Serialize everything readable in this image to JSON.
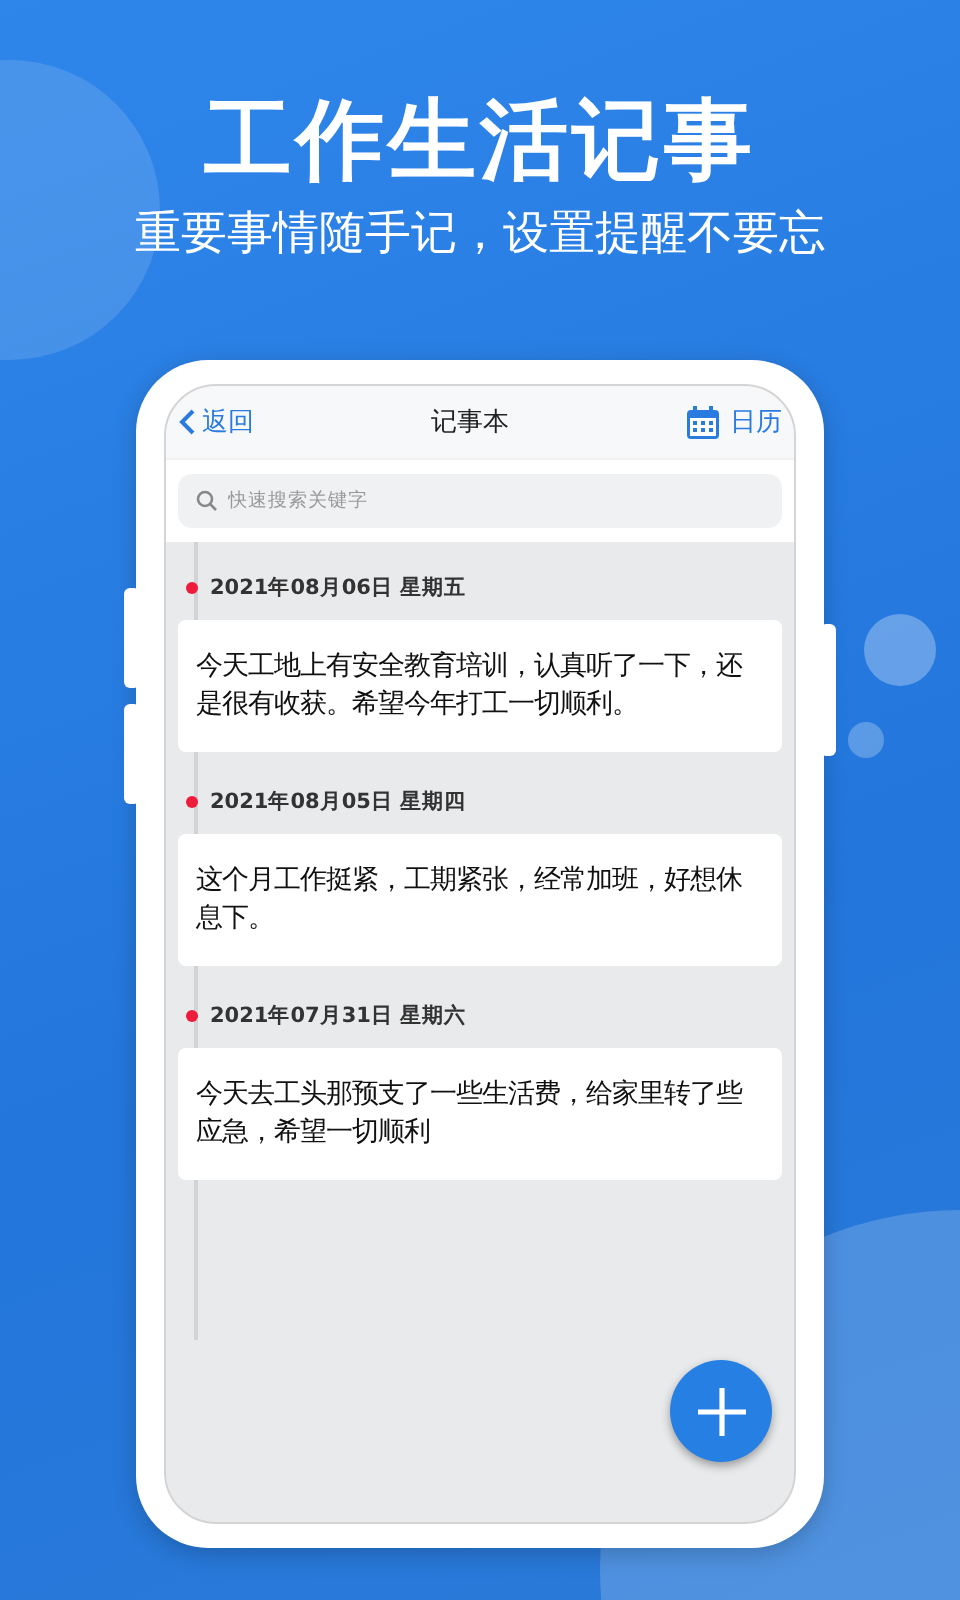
{
  "headline": "工作生活记事",
  "subtitle": "重要事情随手记，设置提醒不要忘",
  "nav": {
    "back": "返回",
    "title": "记事本",
    "calendar": "日历"
  },
  "search": {
    "placeholder": "快速搜索关键字"
  },
  "notes": [
    {
      "date": "2021年08月06日 星期五",
      "text": "今天工地上有安全教育培训，认真听了一下，还是很有收获。希望今年打工一切顺利。"
    },
    {
      "date": "2021年08月05日 星期四",
      "text": "这个月工作挺紧，工期紧张，经常加班，好想休息下。"
    },
    {
      "date": "2021年07月31日 星期六",
      "text": "今天去工头那预支了一些生活费，给家里转了些应急，希望一切顺利"
    }
  ]
}
